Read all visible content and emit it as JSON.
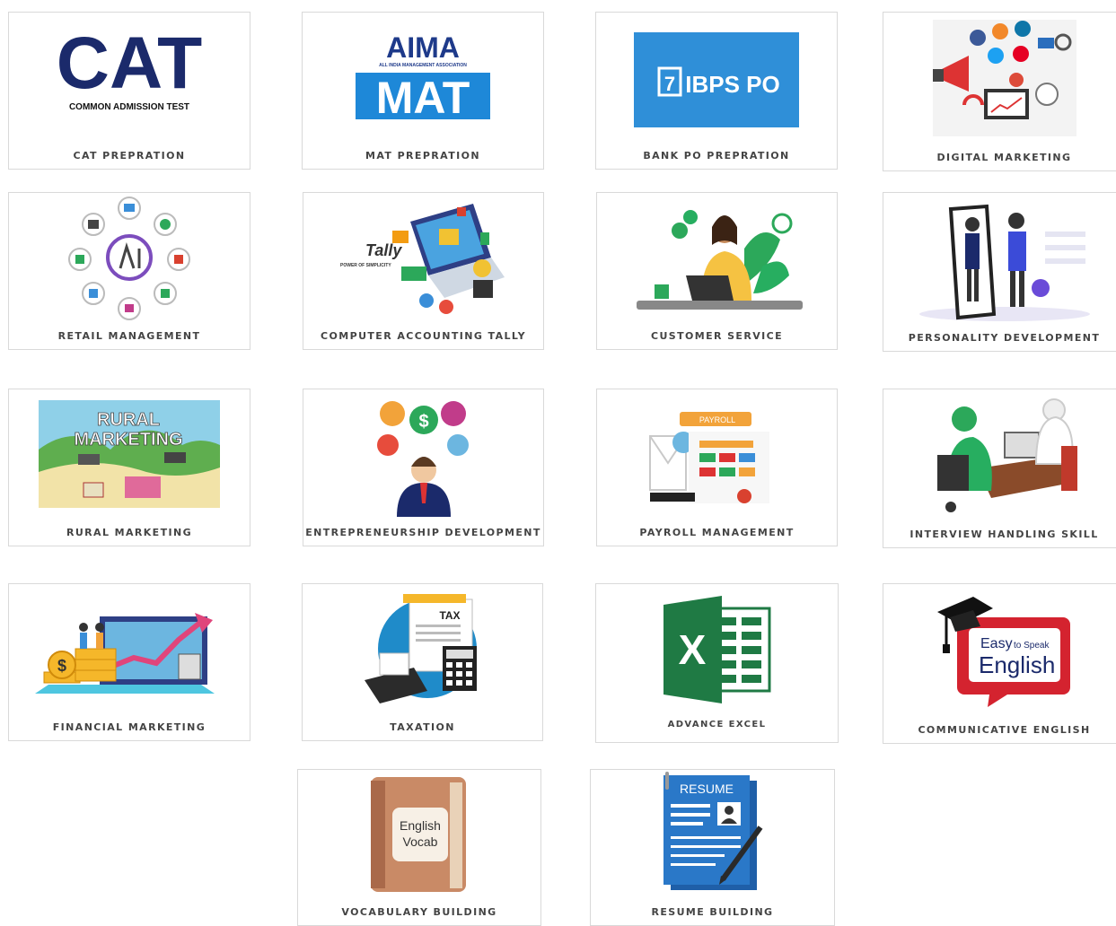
{
  "courses": [
    {
      "label": "CAT PREPRATION",
      "logo_text": "CAT",
      "logo_sub": "COMMON ADMISSION TEST"
    },
    {
      "label": "MAT PREPRATION",
      "logo_top": "AIMA",
      "logo_small": "ALL INDIA MANAGEMENT ASSOCIATION",
      "logo_text": "MAT"
    },
    {
      "label": "BANK PO PREPRATION",
      "logo_text": "IBPS PO"
    },
    {
      "label": "DIGITAL MARKETING"
    },
    {
      "label": "RETAIL MANAGEMENT"
    },
    {
      "label": "COMPUTER ACCOUNTING TALLY",
      "logo_text": "Tally",
      "logo_small": "POWER OF SIMPLICITY"
    },
    {
      "label": "CUSTOMER SERVICE"
    },
    {
      "label": "PERSONALITY DEVELOPMENT"
    },
    {
      "label": "RURAL MARKETING",
      "logo_text": "RURAL",
      "logo_text2": "MARKETING"
    },
    {
      "label": "ENTREPRENEURSHIP DEVELOPMENT"
    },
    {
      "label": "PAYROLL MANAGEMENT",
      "logo_text": "PAYROLL"
    },
    {
      "label": "INTERVIEW HANDLING SKILL"
    },
    {
      "label": "FINANCIAL MARKETING"
    },
    {
      "label": "TAXATION",
      "logo_text": "TAX"
    },
    {
      "label": "ADVANCE EXCEL",
      "logo_text": "X"
    },
    {
      "label": "COMMUNICATIVE ENGLISH",
      "logo_small": "Easy",
      "logo_small2": "to Speak",
      "logo_text": "English"
    },
    {
      "label": "VOCABULARY BUILDING",
      "logo_text": "English",
      "logo_text2": "Vocab"
    },
    {
      "label": "RESUME BUILDING",
      "logo_text": "RESUME"
    }
  ],
  "colors": {
    "cat_blue": "#1b2a6b",
    "mat_blue": "#1e88d8",
    "ibps_blue": "#2f8fd8",
    "excel_green": "#1f7a44",
    "english_red": "#d4232f",
    "resume_blue": "#2a78c8"
  }
}
